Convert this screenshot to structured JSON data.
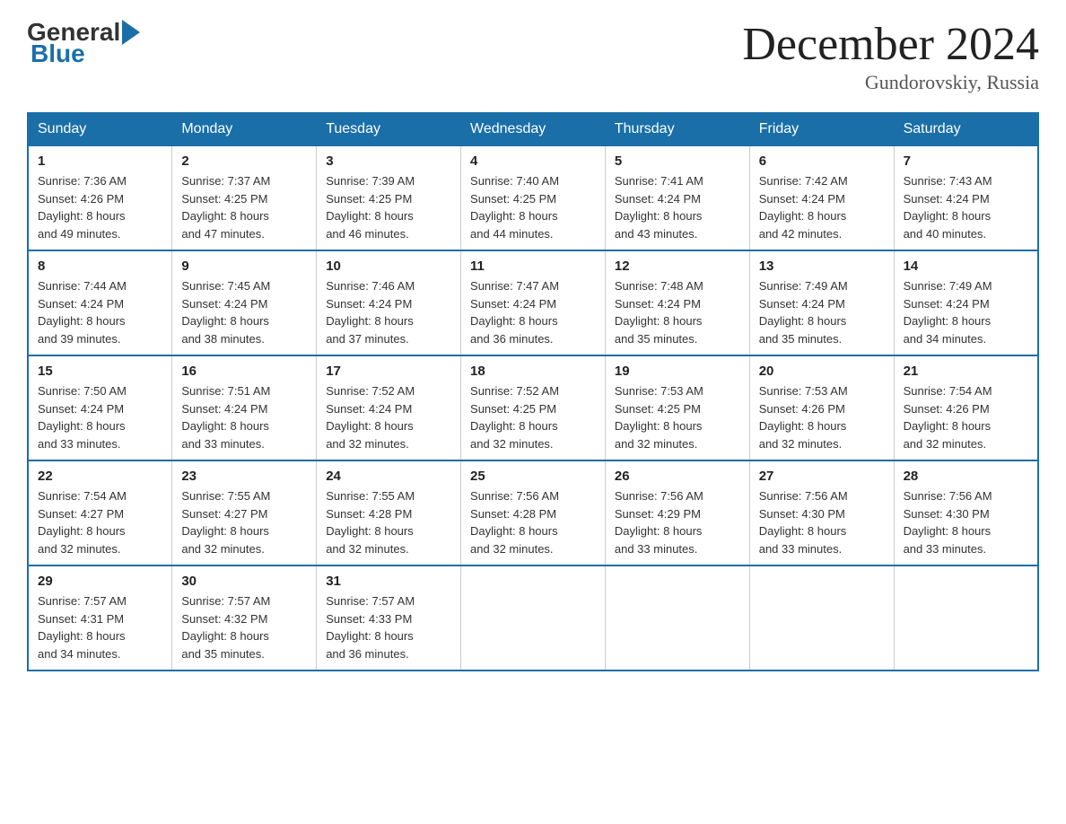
{
  "logo": {
    "general": "General",
    "blue": "Blue"
  },
  "title": "December 2024",
  "location": "Gundorovskiy, Russia",
  "days_header": [
    "Sunday",
    "Monday",
    "Tuesday",
    "Wednesday",
    "Thursday",
    "Friday",
    "Saturday"
  ],
  "weeks": [
    [
      {
        "day": "1",
        "sunrise": "7:36 AM",
        "sunset": "4:26 PM",
        "daylight": "8 hours and 49 minutes."
      },
      {
        "day": "2",
        "sunrise": "7:37 AM",
        "sunset": "4:25 PM",
        "daylight": "8 hours and 47 minutes."
      },
      {
        "day": "3",
        "sunrise": "7:39 AM",
        "sunset": "4:25 PM",
        "daylight": "8 hours and 46 minutes."
      },
      {
        "day": "4",
        "sunrise": "7:40 AM",
        "sunset": "4:25 PM",
        "daylight": "8 hours and 44 minutes."
      },
      {
        "day": "5",
        "sunrise": "7:41 AM",
        "sunset": "4:24 PM",
        "daylight": "8 hours and 43 minutes."
      },
      {
        "day": "6",
        "sunrise": "7:42 AM",
        "sunset": "4:24 PM",
        "daylight": "8 hours and 42 minutes."
      },
      {
        "day": "7",
        "sunrise": "7:43 AM",
        "sunset": "4:24 PM",
        "daylight": "8 hours and 40 minutes."
      }
    ],
    [
      {
        "day": "8",
        "sunrise": "7:44 AM",
        "sunset": "4:24 PM",
        "daylight": "8 hours and 39 minutes."
      },
      {
        "day": "9",
        "sunrise": "7:45 AM",
        "sunset": "4:24 PM",
        "daylight": "8 hours and 38 minutes."
      },
      {
        "day": "10",
        "sunrise": "7:46 AM",
        "sunset": "4:24 PM",
        "daylight": "8 hours and 37 minutes."
      },
      {
        "day": "11",
        "sunrise": "7:47 AM",
        "sunset": "4:24 PM",
        "daylight": "8 hours and 36 minutes."
      },
      {
        "day": "12",
        "sunrise": "7:48 AM",
        "sunset": "4:24 PM",
        "daylight": "8 hours and 35 minutes."
      },
      {
        "day": "13",
        "sunrise": "7:49 AM",
        "sunset": "4:24 PM",
        "daylight": "8 hours and 35 minutes."
      },
      {
        "day": "14",
        "sunrise": "7:49 AM",
        "sunset": "4:24 PM",
        "daylight": "8 hours and 34 minutes."
      }
    ],
    [
      {
        "day": "15",
        "sunrise": "7:50 AM",
        "sunset": "4:24 PM",
        "daylight": "8 hours and 33 minutes."
      },
      {
        "day": "16",
        "sunrise": "7:51 AM",
        "sunset": "4:24 PM",
        "daylight": "8 hours and 33 minutes."
      },
      {
        "day": "17",
        "sunrise": "7:52 AM",
        "sunset": "4:24 PM",
        "daylight": "8 hours and 32 minutes."
      },
      {
        "day": "18",
        "sunrise": "7:52 AM",
        "sunset": "4:25 PM",
        "daylight": "8 hours and 32 minutes."
      },
      {
        "day": "19",
        "sunrise": "7:53 AM",
        "sunset": "4:25 PM",
        "daylight": "8 hours and 32 minutes."
      },
      {
        "day": "20",
        "sunrise": "7:53 AM",
        "sunset": "4:26 PM",
        "daylight": "8 hours and 32 minutes."
      },
      {
        "day": "21",
        "sunrise": "7:54 AM",
        "sunset": "4:26 PM",
        "daylight": "8 hours and 32 minutes."
      }
    ],
    [
      {
        "day": "22",
        "sunrise": "7:54 AM",
        "sunset": "4:27 PM",
        "daylight": "8 hours and 32 minutes."
      },
      {
        "day": "23",
        "sunrise": "7:55 AM",
        "sunset": "4:27 PM",
        "daylight": "8 hours and 32 minutes."
      },
      {
        "day": "24",
        "sunrise": "7:55 AM",
        "sunset": "4:28 PM",
        "daylight": "8 hours and 32 minutes."
      },
      {
        "day": "25",
        "sunrise": "7:56 AM",
        "sunset": "4:28 PM",
        "daylight": "8 hours and 32 minutes."
      },
      {
        "day": "26",
        "sunrise": "7:56 AM",
        "sunset": "4:29 PM",
        "daylight": "8 hours and 33 minutes."
      },
      {
        "day": "27",
        "sunrise": "7:56 AM",
        "sunset": "4:30 PM",
        "daylight": "8 hours and 33 minutes."
      },
      {
        "day": "28",
        "sunrise": "7:56 AM",
        "sunset": "4:30 PM",
        "daylight": "8 hours and 33 minutes."
      }
    ],
    [
      {
        "day": "29",
        "sunrise": "7:57 AM",
        "sunset": "4:31 PM",
        "daylight": "8 hours and 34 minutes."
      },
      {
        "day": "30",
        "sunrise": "7:57 AM",
        "sunset": "4:32 PM",
        "daylight": "8 hours and 35 minutes."
      },
      {
        "day": "31",
        "sunrise": "7:57 AM",
        "sunset": "4:33 PM",
        "daylight": "8 hours and 36 minutes."
      },
      null,
      null,
      null,
      null
    ]
  ],
  "labels": {
    "sunrise": "Sunrise: ",
    "sunset": "Sunset: ",
    "daylight": "Daylight: "
  }
}
